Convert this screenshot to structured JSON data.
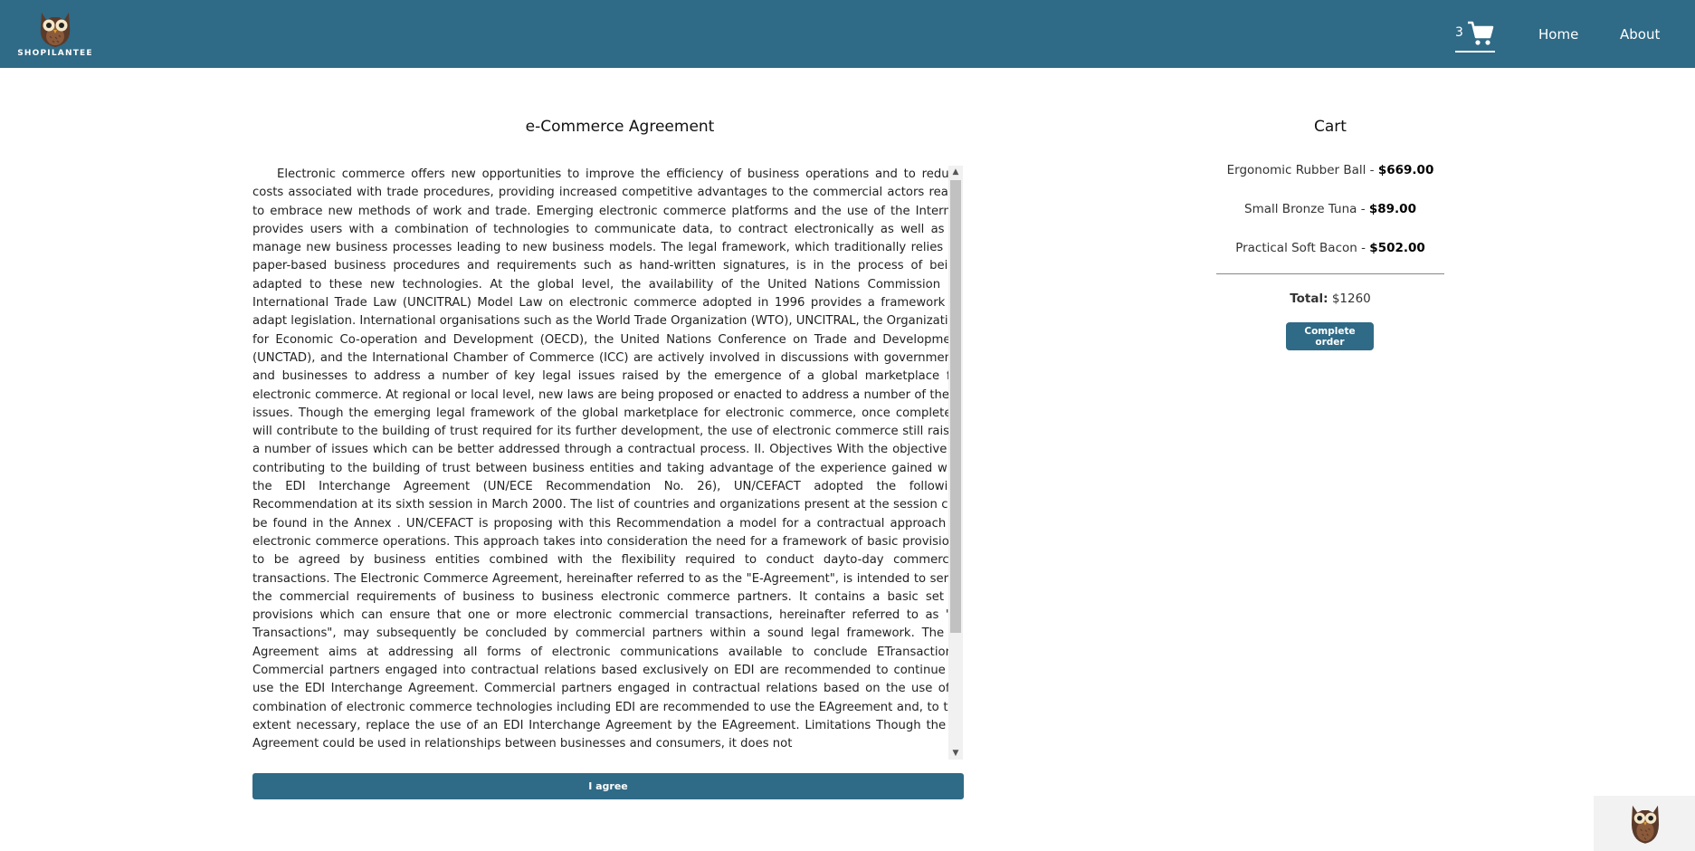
{
  "brand": {
    "name": "SHOPILANTEE"
  },
  "nav": {
    "cart_count": "3",
    "home_label": "Home",
    "about_label": "About"
  },
  "agreement": {
    "title": "e-Commerce Agreement",
    "text": "Electronic commerce offers new opportunities to improve the efficiency of business operations and to reduce costs associated with trade procedures, providing increased competitive advantages to the commercial actors ready to embrace new methods of work and trade. Emerging electronic commerce platforms and the use of the Internet provides users with a combination of technologies to communicate data, to contract electronically as well as to manage new business processes leading to new business models. The legal framework, which traditionally relies on paper-based business procedures and requirements such as hand-written signatures, is in the process of being adapted to these new technologies. At the global level, the availability of the United Nations Commission on International Trade Law (UNCITRAL) Model Law on electronic commerce adopted in 1996 provides a framework to adapt legislation. International organisations such as the World Trade Organization (WTO), UNCITRAL, the Organization for Economic Co-operation and Development (OECD), the United Nations Conference on Trade and Development (UNCTAD), and the International Chamber of Commerce (ICC) are actively involved in discussions with governments and businesses to address a number of key legal issues raised by the emergence of a global marketplace for electronic commerce. At regional or local level, new laws are being proposed or enacted to address a number of these issues. Though the emerging legal framework of the global marketplace for electronic commerce, once completed, will contribute to the building of trust required for its further development, the use of electronic commerce still raises a number of issues which can be better addressed through a contractual process. II. Objectives With the objective of contributing to the building of trust between business entities and taking advantage of the experience gained with the EDI Interchange Agreement (UN/ECE Recommendation No. 26), UN/CEFACT adopted the following Recommendation at its sixth session in March 2000. The list of countries and organizations present at the session can be found in the Annex . UN/CEFACT is proposing with this Recommendation a model for a contractual approach of electronic commerce operations. This approach takes into consideration the need for a framework of basic provisions to be agreed by business entities combined with the flexibility required to conduct dayto-day commercial transactions. The Electronic Commerce Agreement, hereinafter referred to as the \"E-Agreement\", is intended to serve the commercial requirements of business to business electronic commerce partners. It contains a basic set of provisions which can ensure that one or more electronic commercial transactions, hereinafter referred to as \"E-Transactions\", may subsequently be concluded by commercial partners within a sound legal framework. The E-Agreement aims at addressing all forms of electronic communications available to conclude ETransactions. Commercial partners engaged into contractual relations based exclusively on EDI are recommended to continue to use the EDI Interchange Agreement. Commercial partners engaged in contractual relations based on the use of a combination of electronic commerce technologies including EDI are recommended to use the EAgreement and, to the extent necessary, replace the use of an EDI Interchange Agreement by the EAgreement. Limitations Though the E-Agreement could be used in relationships between businesses and consumers, it does not",
    "agree_label": "I agree"
  },
  "cart": {
    "title": "Cart",
    "items": [
      {
        "name": "Ergonomic Rubber Ball",
        "sep": " - ",
        "price": "$669.00"
      },
      {
        "name": "Small Bronze Tuna",
        "sep": " - ",
        "price": "$89.00"
      },
      {
        "name": "Practical Soft Bacon",
        "sep": " - ",
        "price": "$502.00"
      }
    ],
    "total_label": "Total:",
    "total_value": "$1260",
    "complete_label": "Complete order"
  },
  "colors": {
    "brand": "#2f6a86"
  },
  "icons": {
    "cart": "shopping-cart-icon",
    "logo": "owl-logo-icon"
  }
}
